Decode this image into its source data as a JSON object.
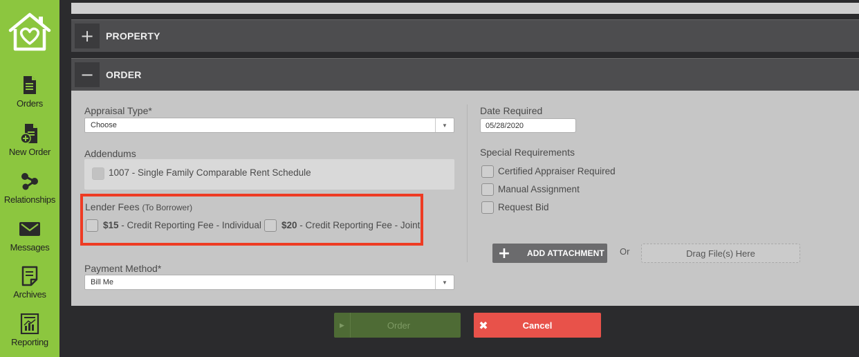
{
  "sidebar": {
    "logo_icon": "house-heart-logo",
    "items": [
      {
        "label": "Orders",
        "icon": "document-icon"
      },
      {
        "label": "New Order",
        "icon": "new-order-icon"
      },
      {
        "label": "Relationships",
        "icon": "relationships-icon"
      },
      {
        "label": "Messages",
        "icon": "envelope-icon"
      },
      {
        "label": "Archives",
        "icon": "archive-icon"
      },
      {
        "label": "Reporting",
        "icon": "chart-icon"
      }
    ]
  },
  "sections": {
    "property": {
      "toggle": "+",
      "title": "PROPERTY"
    },
    "order": {
      "toggle": "−",
      "title": "ORDER"
    }
  },
  "form": {
    "appraisal_type": {
      "label": "Appraisal Type*",
      "value": "Choose"
    },
    "addendums": {
      "label": "Addendums",
      "item": "1007 - Single Family Comparable Rent Schedule"
    },
    "lender_fees": {
      "label": "Lender Fees",
      "sublabel": "(To Borrower)",
      "opt1_amount": "$15",
      "opt1_text": " - Credit Reporting Fee - Individual",
      "opt2_amount": "$20",
      "opt2_text": " - Credit Reporting Fee - Joint"
    },
    "payment_method": {
      "label": "Payment Method*",
      "value": "Bill Me"
    },
    "date_required": {
      "label": "Date Required",
      "value": "05/28/2020"
    },
    "special_requirements": {
      "label": "Special Requirements",
      "items": [
        "Certified Appraiser Required",
        "Manual Assignment",
        "Request Bid"
      ]
    },
    "attachment": {
      "button_label": "ADD ATTACHMENT",
      "or_label": "Or",
      "drop_label": "Drag File(s) Here"
    }
  },
  "actions": {
    "order_label": "Order",
    "cancel_label": "Cancel"
  },
  "colors": {
    "sidebar": "#8cc63f",
    "highlight": "#ee3b23",
    "cancel": "#e8524a",
    "order": "#4e6b35"
  }
}
